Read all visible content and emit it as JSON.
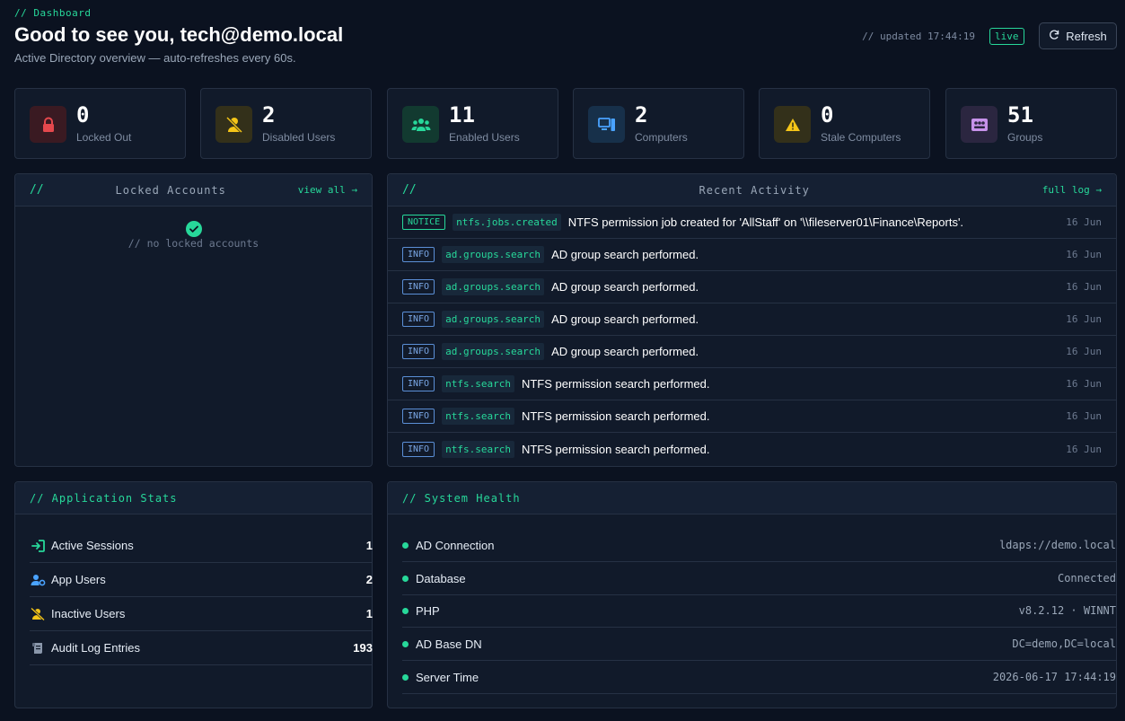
{
  "header": {
    "crumb": "// Dashboard",
    "title": "Good to see you, tech@demo.local",
    "subtitle": "Active Directory overview — auto-refreshes every 60s.",
    "updated": "// updated 17:44:19",
    "live_badge": "live",
    "refresh_label": "Refresh"
  },
  "stats": [
    {
      "value": "0",
      "label": "Locked Out",
      "icon": "lock-icon",
      "color": "#e5484d"
    },
    {
      "value": "2",
      "label": "Disabled Users",
      "icon": "user-slash-icon",
      "color": "#f5c518"
    },
    {
      "value": "11",
      "label": "Enabled Users",
      "icon": "users-icon",
      "color": "#27d89a"
    },
    {
      "value": "2",
      "label": "Computers",
      "icon": "computer-icon",
      "color": "#4aa3ff"
    },
    {
      "value": "0",
      "label": "Stale Computers",
      "icon": "warning-icon",
      "color": "#f5c518"
    },
    {
      "value": "51",
      "label": "Groups",
      "icon": "groups-icon",
      "color": "#c792ea"
    }
  ],
  "locked": {
    "slash": "//",
    "title": "Locked Accounts",
    "link": "view all →",
    "empty": "// no locked accounts"
  },
  "activity": {
    "slash": "//",
    "title": "Recent Activity",
    "link": "full log →",
    "rows": [
      {
        "level": "NOTICE",
        "tag": "ntfs.jobs.created",
        "message": "NTFS permission job created for 'AllStaff' on '\\\\fileserver01\\Finance\\Reports'.",
        "date": "16 Jun"
      },
      {
        "level": "INFO",
        "tag": "ad.groups.search",
        "message": "AD group search performed.",
        "date": "16 Jun"
      },
      {
        "level": "INFO",
        "tag": "ad.groups.search",
        "message": "AD group search performed.",
        "date": "16 Jun"
      },
      {
        "level": "INFO",
        "tag": "ad.groups.search",
        "message": "AD group search performed.",
        "date": "16 Jun"
      },
      {
        "level": "INFO",
        "tag": "ad.groups.search",
        "message": "AD group search performed.",
        "date": "16 Jun"
      },
      {
        "level": "INFO",
        "tag": "ntfs.search",
        "message": "NTFS permission search performed.",
        "date": "16 Jun"
      },
      {
        "level": "INFO",
        "tag": "ntfs.search",
        "message": "NTFS permission search performed.",
        "date": "16 Jun"
      },
      {
        "level": "INFO",
        "tag": "ntfs.search",
        "message": "NTFS permission search performed.",
        "date": "16 Jun"
      }
    ]
  },
  "app_stats": {
    "title": "// Application Stats",
    "rows": [
      {
        "label": "Active Sessions",
        "value": "1",
        "icon": "sign-in-icon",
        "color": "#27d89a"
      },
      {
        "label": "App Users",
        "value": "2",
        "icon": "user-gear-icon",
        "color": "#4aa3ff"
      },
      {
        "label": "Inactive Users",
        "value": "1",
        "icon": "user-slash-icon",
        "color": "#f5c518"
      },
      {
        "label": "Audit Log Entries",
        "value": "193",
        "icon": "scroll-icon",
        "color": "#8a97ab"
      }
    ]
  },
  "health": {
    "title": "// System Health",
    "rows": [
      {
        "label": "AD Connection",
        "value": "ldaps://demo.local"
      },
      {
        "label": "Database",
        "value": "Connected"
      },
      {
        "label": "PHP",
        "value": "v8.2.12 · WINNT"
      },
      {
        "label": "AD Base DN",
        "value": "DC=demo,DC=local"
      },
      {
        "label": "Server Time",
        "value": "2026-06-17 17:44:19"
      }
    ]
  }
}
